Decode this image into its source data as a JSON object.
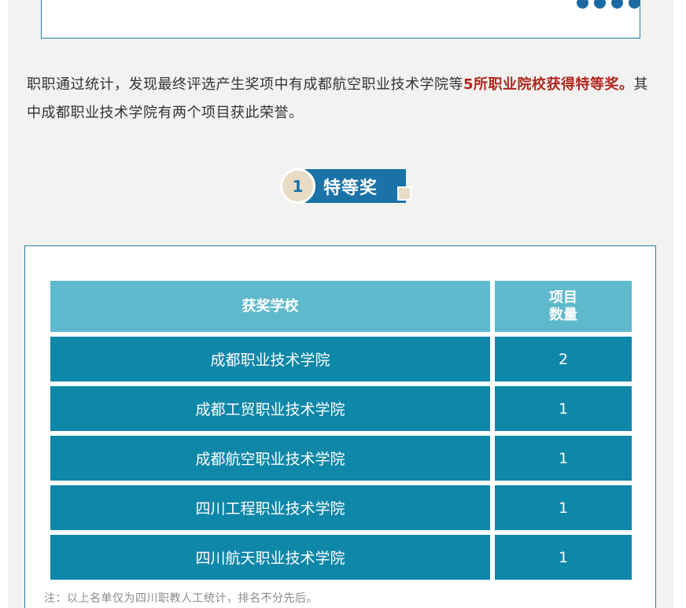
{
  "intro": {
    "part1": "职职通过统计，发现最终评选产生奖项中有成都航空职业技术学院等",
    "highlight": "5所职业院校获得特等奖。",
    "part2": "其中成都职业技术学院有两个项目获此荣誉。"
  },
  "section": {
    "number": "1",
    "title": "特等奖"
  },
  "table": {
    "headers": [
      "获奖学校",
      "项目\n数量"
    ],
    "rows": [
      [
        "成都职业技术学院",
        "2"
      ],
      [
        "成都工贸职业技术学院",
        "1"
      ],
      [
        "成都航空职业技术学院",
        "1"
      ],
      [
        "四川工程职业技术学院",
        "1"
      ],
      [
        "四川航天职业技术学院",
        "1"
      ]
    ]
  },
  "note": "注：以上名单仅为四川职教人工统计，排名不分先后。",
  "colors": {
    "accent_red": "#b2261f",
    "header_teal": "#5fb9cc",
    "row_teal": "#0f87a8",
    "badge_blue": "#1a72a6",
    "badge_beige": "#e8dcc7"
  }
}
